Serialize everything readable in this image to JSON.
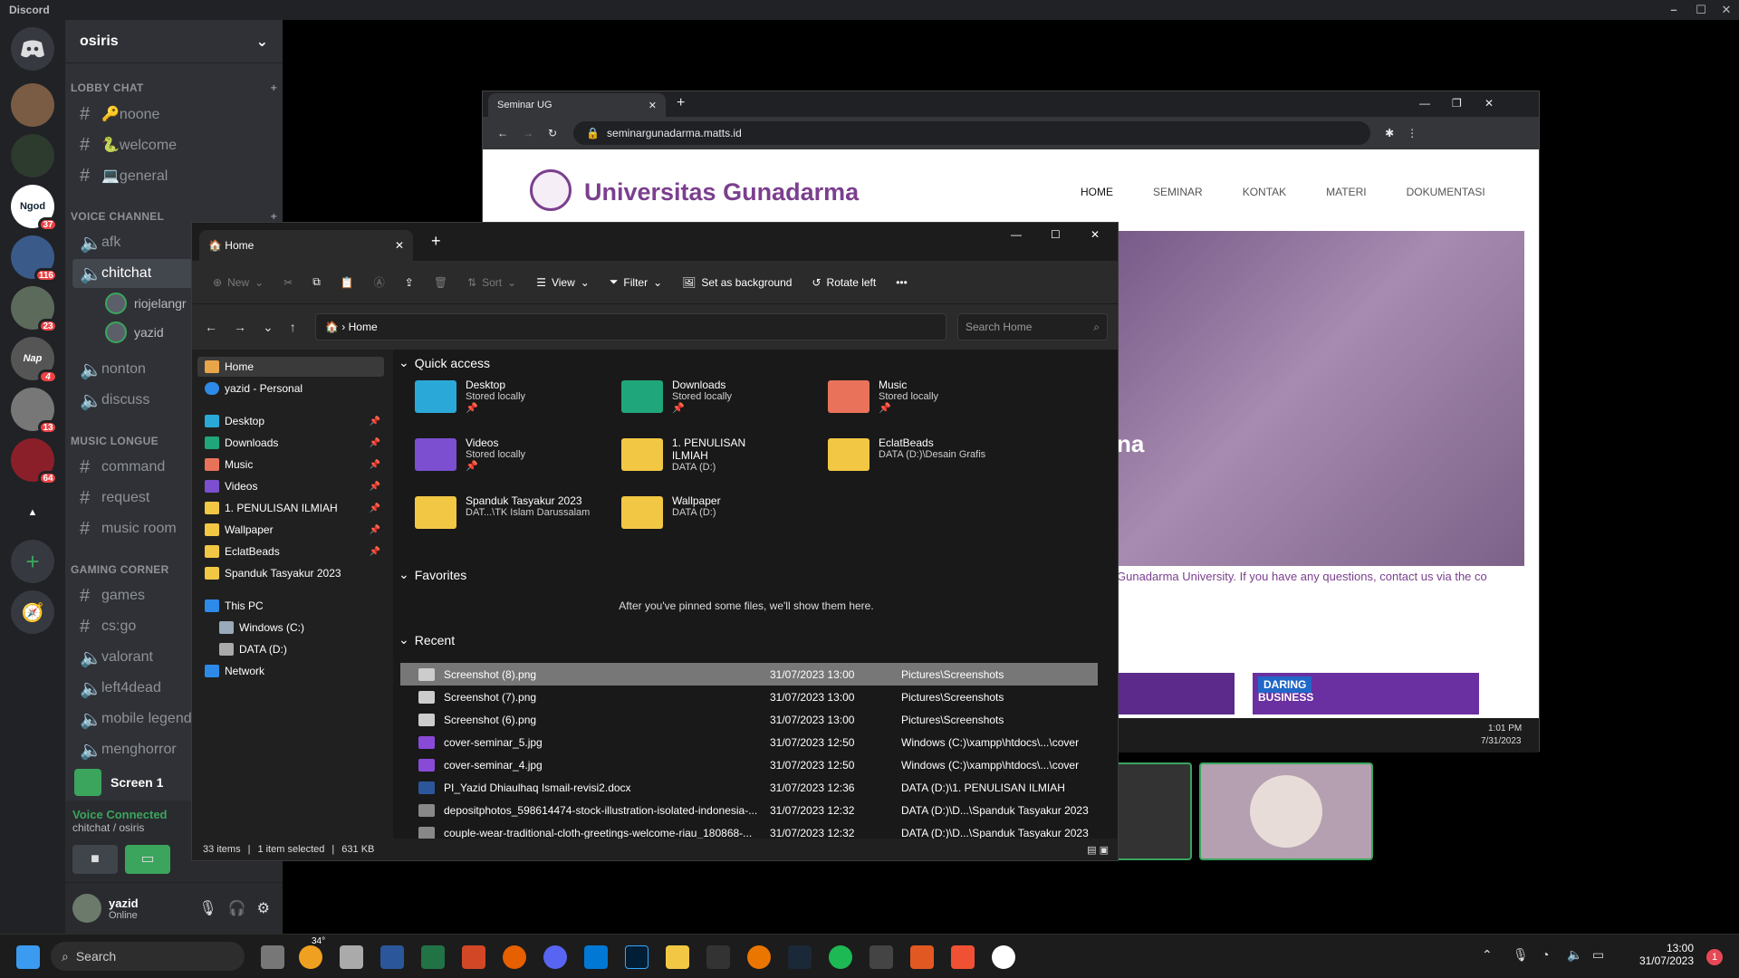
{
  "discord": {
    "title": "Discord",
    "server_name": "osiris",
    "categories": [
      "LOBBY CHAT",
      "VOICE CHANNEL",
      "MUSIC LONGUE",
      "GAMING CORNER"
    ],
    "lobby": [
      "🔑noone",
      "🐍welcome",
      "💻general"
    ],
    "voice": [
      "afk",
      "chitchat",
      "nonton",
      "discuss"
    ],
    "voice_users": [
      "riojelangr",
      "yazid"
    ],
    "music": [
      "command",
      "request",
      "music room"
    ],
    "gaming": [
      "games",
      "cs:go",
      "valorant",
      "left4dead",
      "mobile legend",
      "menghorror"
    ],
    "servers": [
      {
        "label": "",
        "badge": ""
      },
      {
        "label": "",
        "badge": ""
      },
      {
        "label": "Ngod",
        "badge": "37"
      },
      {
        "label": "",
        "badge": "116"
      },
      {
        "label": "",
        "badge": "23"
      },
      {
        "label": "Nap",
        "badge": "4"
      },
      {
        "label": "",
        "badge": "13"
      },
      {
        "label": "",
        "badge": "64"
      }
    ],
    "screen_label": "Screen 1",
    "voice_connected": "Voice Connected",
    "voice_location": "chitchat / osiris",
    "user": {
      "name": "yazid",
      "status": "Online"
    }
  },
  "browser": {
    "tab_title": "Seminar UG",
    "url": "seminargunadarma.matts.id",
    "site_title": "Universitas Gunadarma",
    "nav": [
      "HOME",
      "SEMINAR",
      "KONTAK",
      "MATERI",
      "DOKUMENTASI"
    ],
    "hero_fragment": "na",
    "marquee": "Gunadarma University. If you have any questions, contact us via the co",
    "card_label": "DARING",
    "card_text": "BUSINESS",
    "time": "1:01 PM",
    "date": "7/31/2023"
  },
  "explorer": {
    "tab": "Home",
    "toolbar": {
      "new": "New",
      "sort": "Sort",
      "view": "View",
      "filter": "Filter",
      "bg": "Set as background",
      "rotate": "Rotate left",
      "more": "•••"
    },
    "address": "Home",
    "search_placeholder": "Search Home",
    "nav": {
      "home": "Home",
      "personal": "yazid - Personal",
      "pinned": [
        "Desktop",
        "Downloads",
        "Music",
        "Videos",
        "1. PENULISAN ILMIAH",
        "Wallpaper",
        "EclatBeads"
      ],
      "extra": "Spanduk Tasyakur 2023",
      "thispc": "This PC",
      "c": "Windows (C:)",
      "d": "DATA (D:)",
      "network": "Network"
    },
    "quick_access_title": "Quick access",
    "quick": [
      {
        "name": "Desktop",
        "loc": "Stored locally",
        "color": "#2aa8d8"
      },
      {
        "name": "Downloads",
        "loc": "Stored locally",
        "color": "#1fa67a"
      },
      {
        "name": "Music",
        "loc": "Stored locally",
        "color": "#e8735a"
      },
      {
        "name": "Videos",
        "loc": "Stored locally",
        "color": "#7b4fcf"
      },
      {
        "name": "1. PENULISAN ILMIAH",
        "loc": "DATA (D:)",
        "color": "#f2c744"
      },
      {
        "name": "EclatBeads",
        "loc": "DATA (D:)\\Desain Grafis",
        "color": "#f2c744"
      },
      {
        "name": "Spanduk Tasyakur 2023",
        "loc": "DAT...\\TK Islam Darussalam",
        "color": "#f2c744"
      },
      {
        "name": "Wallpaper",
        "loc": "DATA (D:)",
        "color": "#f2c744"
      }
    ],
    "favorites_title": "Favorites",
    "favorites_empty": "After you've pinned some files, we'll show them here.",
    "recent_title": "Recent",
    "recent": [
      {
        "name": "Screenshot (8).png",
        "date": "31/07/2023 13:00",
        "loc": "Pictures\\Screenshots"
      },
      {
        "name": "Screenshot (7).png",
        "date": "31/07/2023 13:00",
        "loc": "Pictures\\Screenshots"
      },
      {
        "name": "Screenshot (6).png",
        "date": "31/07/2023 13:00",
        "loc": "Pictures\\Screenshots"
      },
      {
        "name": "cover-seminar_5.jpg",
        "date": "31/07/2023 12:50",
        "loc": "Windows (C:)\\xampp\\htdocs\\...\\cover"
      },
      {
        "name": "cover-seminar_4.jpg",
        "date": "31/07/2023 12:50",
        "loc": "Windows (C:)\\xampp\\htdocs\\...\\cover"
      },
      {
        "name": "PI_Yazid Dhiaulhaq Ismail-revisi2.docx",
        "date": "31/07/2023 12:36",
        "loc": "DATA (D:)\\1. PENULISAN ILMIAH"
      },
      {
        "name": "depositphotos_598614474-stock-illustration-isolated-indonesia-...",
        "date": "31/07/2023 12:32",
        "loc": "DATA (D:)\\D...\\Spanduk Tasyakur 2023"
      },
      {
        "name": "couple-wear-traditional-cloth-greetings-welcome-riau_180868-...",
        "date": "31/07/2023 12:32",
        "loc": "DATA (D:)\\D...\\Spanduk Tasyakur 2023"
      }
    ],
    "status": {
      "items": "33 items",
      "selected": "1 item selected",
      "size": "631 KB"
    }
  },
  "taskbar": {
    "search": "Search",
    "weather": "34°",
    "time": "13:00",
    "date": "31/07/2023",
    "notif": "1"
  }
}
